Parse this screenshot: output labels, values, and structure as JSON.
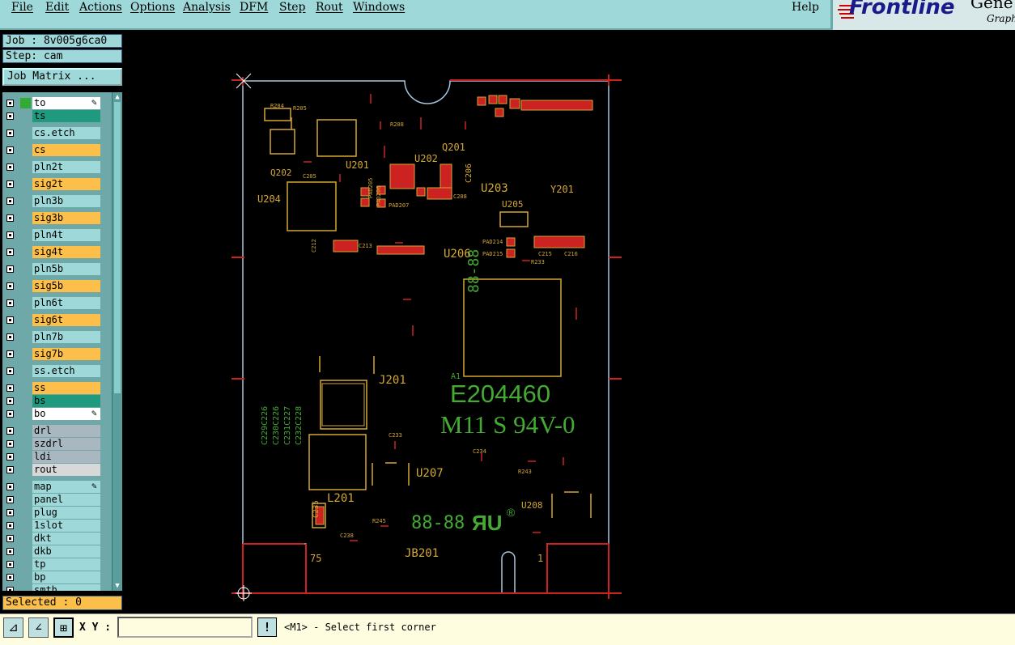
{
  "menubar": {
    "items": [
      "File",
      "Edit",
      "Actions",
      "Options",
      "Analysis",
      "DFM",
      "Step",
      "Rout",
      "Windows"
    ],
    "help": "Help"
  },
  "logo": {
    "brand": "Frontline",
    "product_partial": "Gene",
    "sub_partial": "Graph"
  },
  "job": {
    "label": "Job : 8v005g6ca0",
    "step": "Step: cam",
    "matrix_button": "Job Matrix ..."
  },
  "layers": [
    {
      "name": "to",
      "color": "#ffffff",
      "mark": "#33aa33",
      "pencil": true
    },
    {
      "name": "ts",
      "color": "#1f9a7e"
    },
    {
      "name": "cs.etch",
      "color": "#9fd8d8"
    },
    {
      "name": "cs",
      "color": "#fcbf4a"
    },
    {
      "name": "pln2t",
      "color": "#9fd8d8"
    },
    {
      "name": "sig2t",
      "color": "#fcbf4a"
    },
    {
      "name": "pln3b",
      "color": "#9fd8d8"
    },
    {
      "name": "sig3b",
      "color": "#fcbf4a"
    },
    {
      "name": "pln4t",
      "color": "#9fd8d8"
    },
    {
      "name": "sig4t",
      "color": "#fcbf4a"
    },
    {
      "name": "pln5b",
      "color": "#9fd8d8"
    },
    {
      "name": "sig5b",
      "color": "#fcbf4a"
    },
    {
      "name": "pln6t",
      "color": "#9fd8d8"
    },
    {
      "name": "sig6t",
      "color": "#fcbf4a"
    },
    {
      "name": "pln7b",
      "color": "#9fd8d8"
    },
    {
      "name": "sig7b",
      "color": "#fcbf4a"
    },
    {
      "name": "ss.etch",
      "color": "#9fd8d8"
    },
    {
      "name": "ss",
      "color": "#fcbf4a"
    },
    {
      "name": "bs",
      "color": "#1f9a7e"
    },
    {
      "name": "bo",
      "color": "#ffffff",
      "pencil": true
    },
    {
      "name": "drl",
      "color": "#a9b8c0"
    },
    {
      "name": "szdrl",
      "color": "#a9b8c0"
    },
    {
      "name": "ldi",
      "color": "#a9b8c0"
    },
    {
      "name": "rout",
      "color": "#d8d8d8"
    },
    {
      "name": "map",
      "color": "#9fd8d8",
      "pencil": true
    },
    {
      "name": "panel",
      "color": "#9fd8d8"
    },
    {
      "name": "plug",
      "color": "#9fd8d8"
    },
    {
      "name": "1slot",
      "color": "#9fd8d8"
    },
    {
      "name": "dkt",
      "color": "#9fd8d8"
    },
    {
      "name": "dkb",
      "color": "#9fd8d8"
    },
    {
      "name": "tp",
      "color": "#9fd8d8"
    },
    {
      "name": "bp",
      "color": "#9fd8d8"
    },
    {
      "name": "smth",
      "color": "#9fd8d8"
    }
  ],
  "selected": "Selected : 0",
  "status": {
    "xy_label": "X Y :",
    "xy_value": "",
    "prompt": "<M1> - Select first corner"
  },
  "pcb": {
    "refs": [
      "U201",
      "U202",
      "U203",
      "U204",
      "U205",
      "U206",
      "U207",
      "U208",
      "Q201",
      "Q202",
      "Y201",
      "J201",
      "L201",
      "JB201",
      "C205",
      "C206",
      "C208",
      "C212",
      "C213",
      "C215",
      "C216",
      "C233",
      "C234",
      "C235",
      "C238",
      "R204",
      "R205",
      "R208",
      "R233",
      "R243",
      "R245",
      "PAD205",
      "PAD206",
      "PAD207",
      "PAD214",
      "PAD215"
    ],
    "marking_1": "E204460",
    "marking_2": "M11 S 94V-0",
    "datecode": "88-88",
    "pin_marker": "A1",
    "corner_label": "75",
    "corner_label_2": "1"
  },
  "colors": {
    "outline": "#a8c8e0",
    "pads": "#cc2222",
    "silk": "#d4a832",
    "text": "#44aa33"
  }
}
